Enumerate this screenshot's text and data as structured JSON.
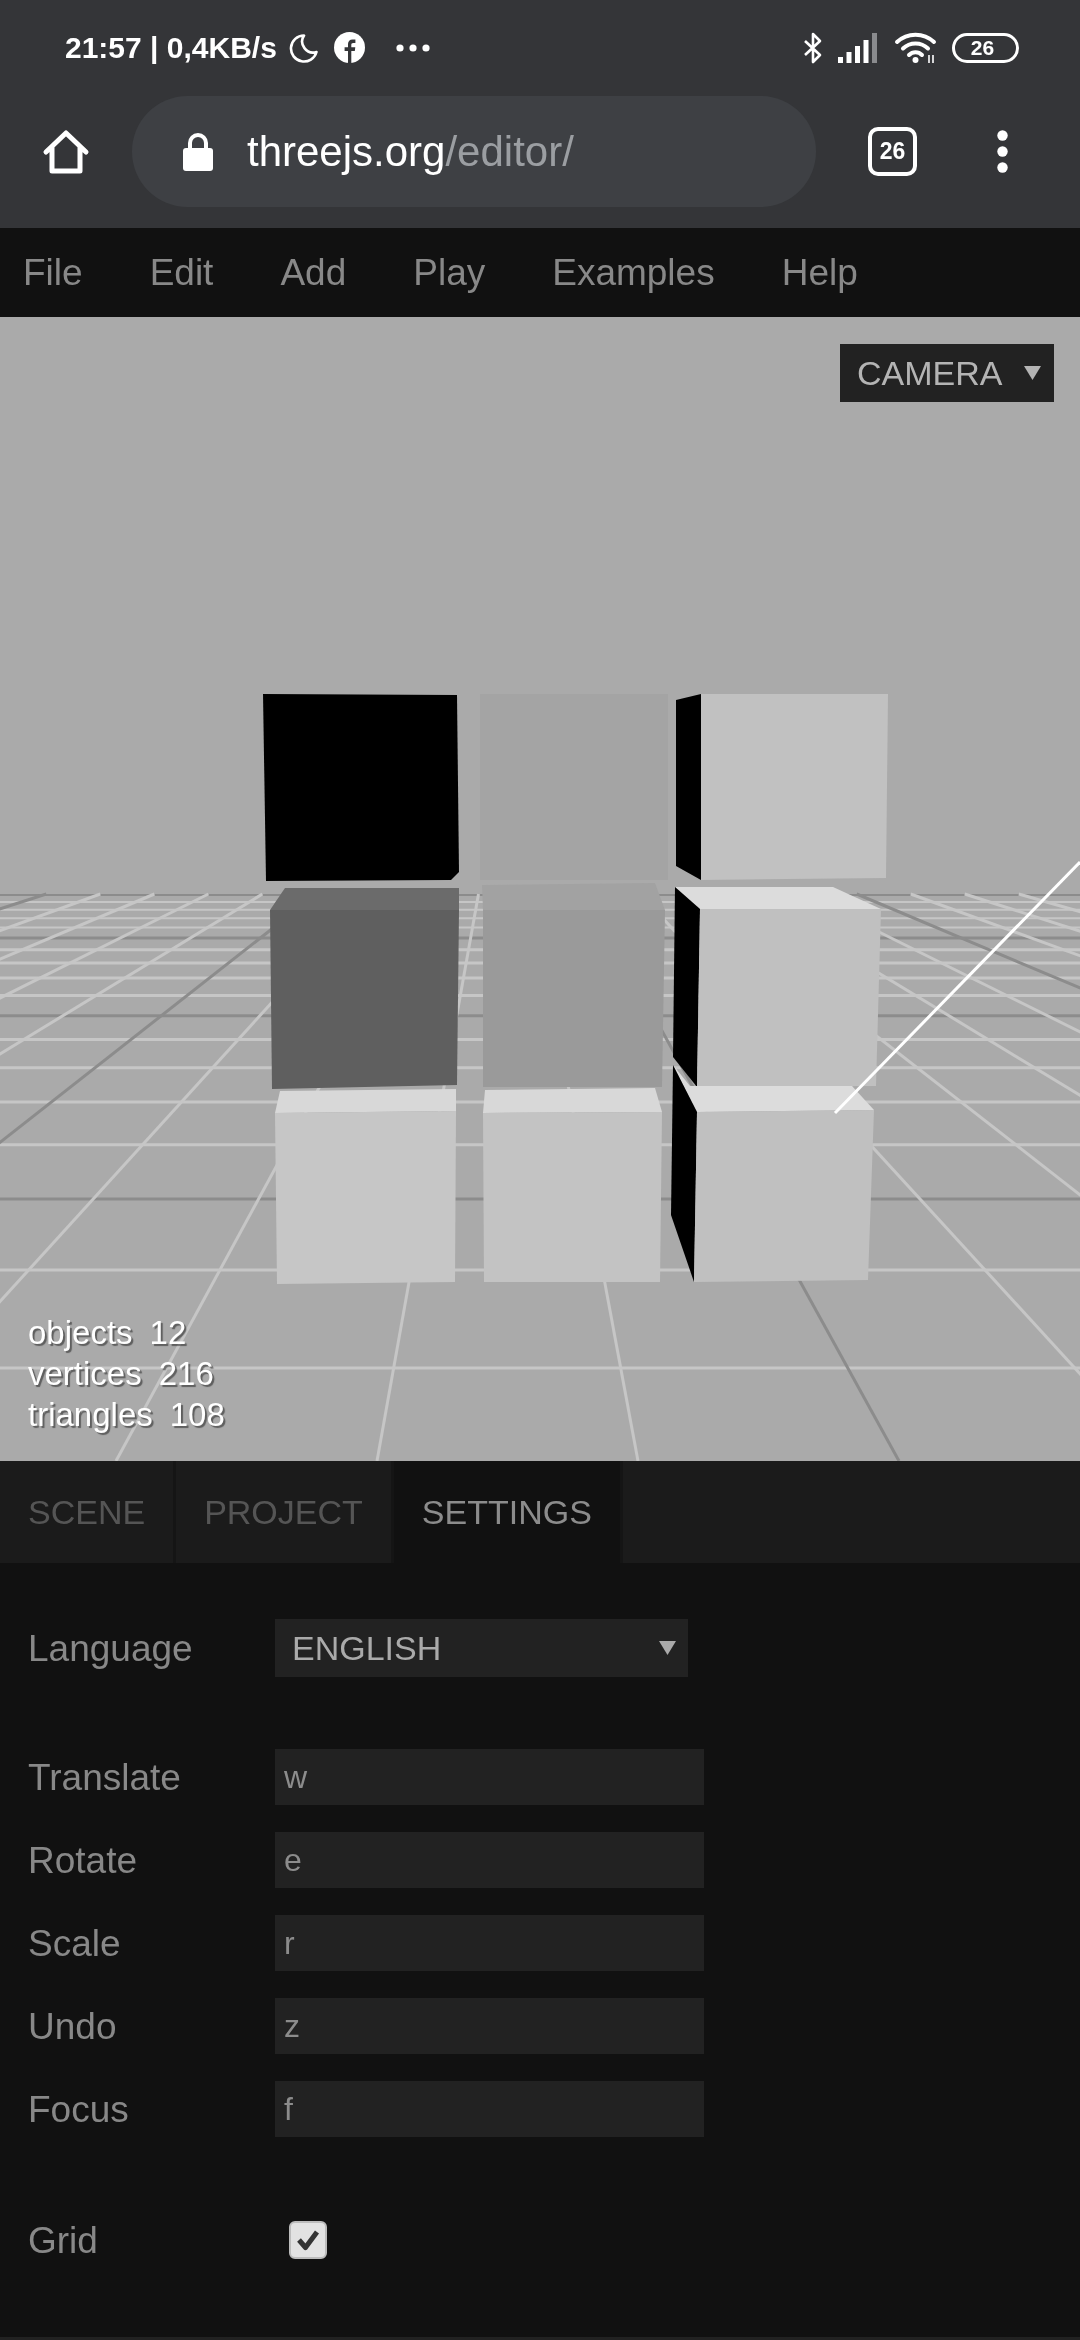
{
  "status_bar": {
    "clock": "21:57 | 0,4KB/s",
    "battery": "26"
  },
  "browser": {
    "url_host": "threejs.org",
    "url_path": "/editor/",
    "tab_count": "26"
  },
  "menu": [
    "File",
    "Edit",
    "Add",
    "Play",
    "Examples",
    "Help"
  ],
  "viewport": {
    "camera": "CAMERA",
    "stats": [
      {
        "label": "objects",
        "value": "12"
      },
      {
        "label": "vertices",
        "value": "216"
      },
      {
        "label": "triangles",
        "value": "108"
      }
    ]
  },
  "tabs": [
    {
      "label": "SCENE",
      "selected": false
    },
    {
      "label": "PROJECT",
      "selected": false
    },
    {
      "label": "SETTINGS",
      "selected": true
    }
  ],
  "settings": {
    "language": {
      "label": "Language",
      "value": "ENGLISH"
    },
    "shortcuts": [
      {
        "label": "Translate",
        "value": "w"
      },
      {
        "label": "Rotate",
        "value": "e"
      },
      {
        "label": "Scale",
        "value": "r"
      },
      {
        "label": "Undo",
        "value": "z"
      },
      {
        "label": "Focus",
        "value": "f"
      }
    ],
    "grid": {
      "label": "Grid",
      "checked": true
    }
  }
}
